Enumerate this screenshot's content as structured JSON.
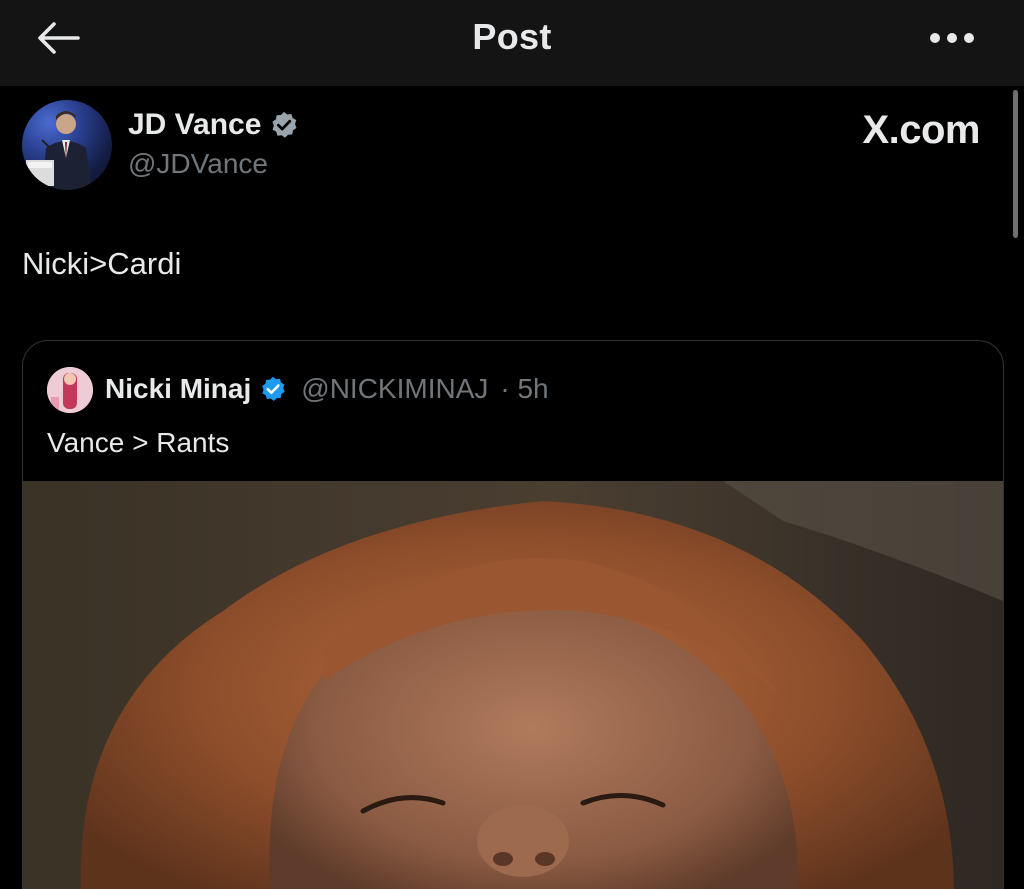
{
  "topbar": {
    "title": "Post",
    "back_icon": "arrow-left-icon",
    "more_icon": "more-dots-icon"
  },
  "post": {
    "author": {
      "name": "JD Vance",
      "handle": "@JDVance",
      "verified": true
    },
    "source_label": "X.com",
    "text": "Nicki>Cardi"
  },
  "quote": {
    "author": {
      "name": "Nicki Minaj",
      "handle": "@NICKIMINAJ",
      "verified": true
    },
    "time": "· 5h",
    "text": "Vance > Rants"
  },
  "colors": {
    "background": "#000000",
    "topbar": "#141414",
    "verified": "#1d9bf0",
    "muted": "#71767b"
  }
}
